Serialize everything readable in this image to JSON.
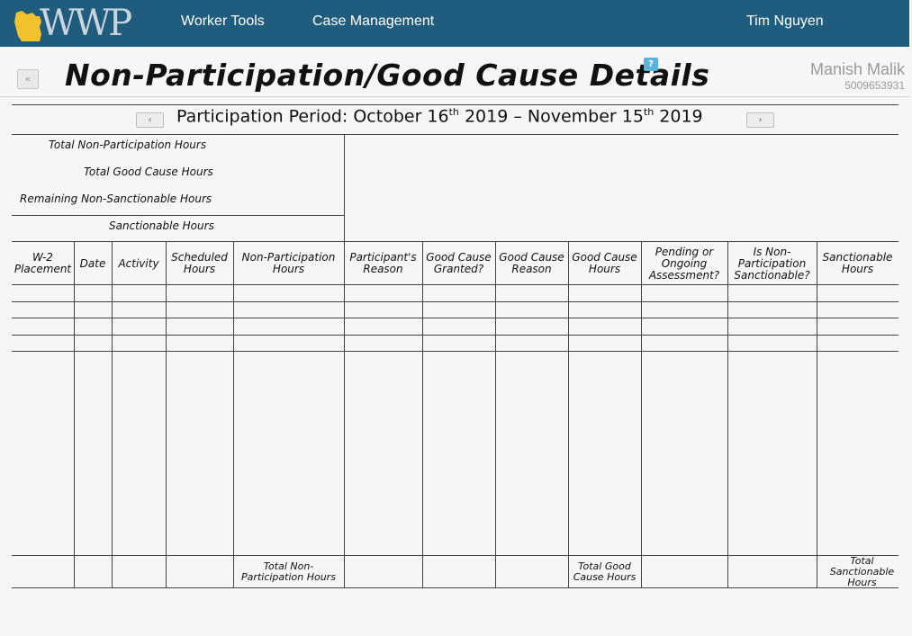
{
  "header": {
    "logo_text": "WWP",
    "nav": {
      "worker_tools": "Worker Tools",
      "case_management": "Case Management"
    },
    "user_name": "Tim Nguyen"
  },
  "title_bar": {
    "back_label": "«",
    "title": "Non-Participation/Good Cause Details",
    "help_label": "?",
    "participant_name": "Manish Malik",
    "participant_id": "5009653931"
  },
  "period": {
    "prefix": "Participation Period: ",
    "start_month": "October 16",
    "start_sup": "th",
    "start_year": " 2019 – November 15",
    "end_sup": "th",
    "end_year": " 2019",
    "prev_label": "‹",
    "next_label": "›"
  },
  "summary": {
    "total_non_participation": "Total Non-Participation Hours",
    "total_good_cause": "Total Good Cause Hours",
    "remaining_non_sanctionable": "Remaining Non-Sanctionable Hours",
    "sanctionable": "Sanctionable Hours"
  },
  "table": {
    "columns": [
      "W-2 Placement",
      "Date",
      "Activity",
      "Scheduled Hours",
      "Non-Participation Hours",
      "Participant's Reason",
      "Good Cause Granted?",
      "Good Cause Reason",
      "Good Cause Hours",
      "Pending or Ongoing Assessment?",
      "Is Non-Participation Sanctionable?",
      "Sanctionable Hours"
    ],
    "footer": {
      "total_non_participation": "Total Non-Participation Hours",
      "total_good_cause": "Total Good Cause Hours",
      "total_sanctionable": "Total Sanctionable Hours"
    }
  }
}
